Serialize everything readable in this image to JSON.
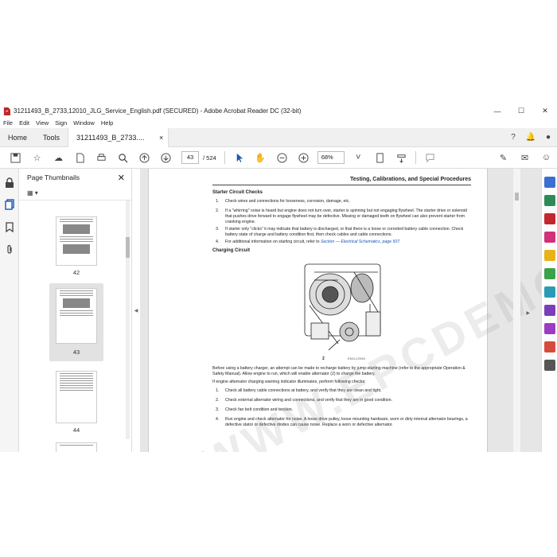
{
  "window": {
    "title": "31211493_B_2733,12010_JLG_Service_English.pdf (SECURED) - Adobe Acrobat Reader DC (32-bit)",
    "minimize_icon": "minimize-icon",
    "maximize_icon": "maximize-icon",
    "close_icon": "close-icon"
  },
  "menu": [
    "File",
    "Edit",
    "View",
    "Sign",
    "Window",
    "Help"
  ],
  "tabs": {
    "home": "Home",
    "tools": "Tools",
    "document": "31211493_B_2733....",
    "close": "×"
  },
  "toolbar": {
    "current_page": "43",
    "total_pages": "/ 524",
    "zoom": "68%"
  },
  "thumbnails": {
    "title": "Page Thumbnails",
    "pages": [
      "42",
      "43",
      "44"
    ]
  },
  "page": {
    "header": "Testing, Calibrations, and Special Procedures",
    "section1": "Starter Circuit Checks",
    "starter_items": [
      {
        "n": "1.",
        "text": "Check wires and connections for looseness, corrosion, damage, etc."
      },
      {
        "n": "2.",
        "text": "If a \"whirring\" noise is heard but engine does not turn over, starter is spinning but not engaging flywheel. The starter drive or solenoid that pushes drive forward to engage flywheel may be defective. Missing or damaged teeth on flywheel can also prevent starter from cranking engine."
      },
      {
        "n": "3.",
        "text": "If starter only \"clicks\" it may indicate that battery is discharged, or that there is a loose or corroded battery cable connection. Check battery state of charge and battery condition first, then check cables and cable connections."
      },
      {
        "n": "4.",
        "text": "For additional information on starting circuit, refer to ",
        "link": "Section — Electrical Schematics, page 507."
      }
    ],
    "section2": "Charging Circuit",
    "figure_callout": "2",
    "figure_id": "EN1LC2940",
    "para1": "Before using a battery charger, an attempt can be made to recharge battery by jump-starting machine (refer to the appropriate Operation & Safety Manual). Allow engine to run, which will enable alternator (2) to charge the battery.",
    "para2": "If engine alternator charging warning indicator illuminates, perform following checks:",
    "charging_items": [
      {
        "n": "1.",
        "text": "Check all battery cable connections at battery, and verify that they are clean and tight."
      },
      {
        "n": "2.",
        "text": "Check external alternator wiring and connections, and verify that they are in good condition."
      },
      {
        "n": "3.",
        "text": "Check fan belt condition and tension."
      },
      {
        "n": "4.",
        "text": "Run engine and check alternator for noise. A loose drive pulley, loose mounting hardware, worn or dirty internal alternator bearings, a defective stator or defective diodes can cause noise. Replace a worn or defective alternator."
      }
    ],
    "watermark": "WWW.EPCDEMO.COM"
  },
  "colors": {
    "accent": "#1a56b0",
    "pdf_red": "#c1272d"
  }
}
